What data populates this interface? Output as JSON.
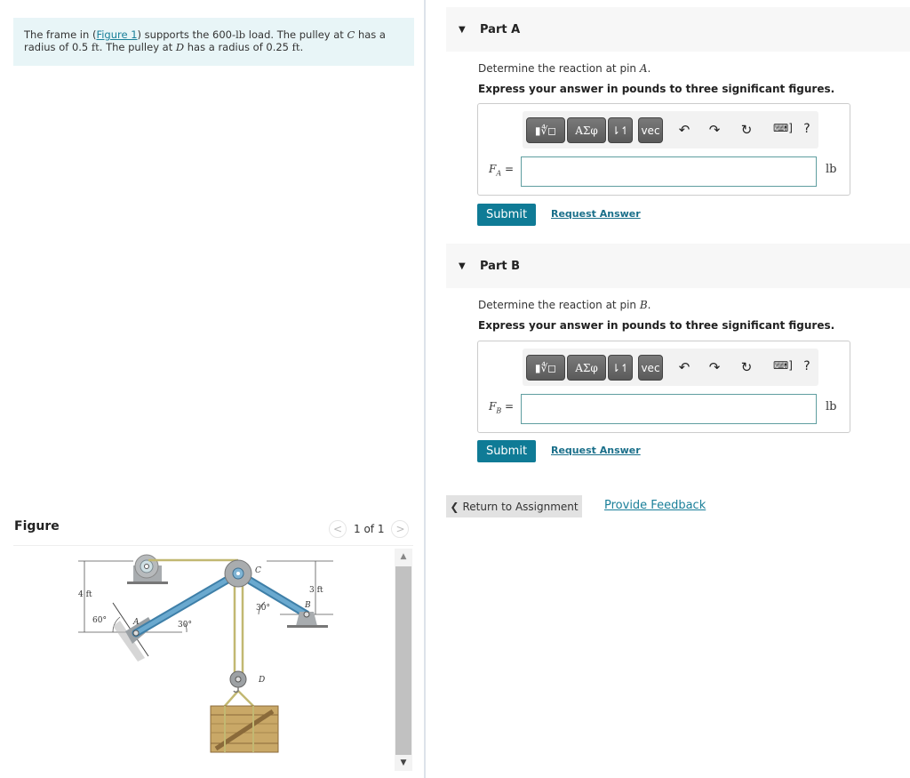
{
  "problem": {
    "text_before": "The frame in (",
    "link": "Figure 1",
    "text_mid1": ") supports the 600-",
    "unit_lb": "lb",
    "text_mid2": " load. The pulley at ",
    "C": "C",
    "text_mid3": " has a radius of 0.5 ",
    "unit_ft": "ft",
    "text_mid4": ". The pulley at ",
    "D": "D",
    "text_mid5": " has a radius of 0.25 ",
    "unit_ft2": "ft",
    "text_end": "."
  },
  "figure": {
    "title": "Figure",
    "counter": "1 of 1",
    "prev": "<",
    "next": ">",
    "labels": {
      "dim_left": "4 ft",
      "dim_right": "3 ft",
      "angle_60": "60°",
      "angle_30_A": "30°",
      "angle_30_C": "30°",
      "A": "A",
      "B": "B",
      "C": "C",
      "D": "D"
    }
  },
  "parts": [
    {
      "title": "Part A",
      "question_prefix": "Determine the reaction at pin ",
      "pin": "A",
      "question_suffix": ".",
      "instruction": "Express your answer in pounds to three significant figures.",
      "var": "F",
      "var_sub": "A",
      "equals": "=",
      "value": "",
      "unit": "lb",
      "submit": "Submit",
      "request": "Request Answer"
    },
    {
      "title": "Part B",
      "question_prefix": "Determine the reaction at pin ",
      "pin": "B",
      "question_suffix": ".",
      "instruction": "Express your answer in pounds to three significant figures.",
      "var": "F",
      "var_sub": "B",
      "equals": "=",
      "value": "",
      "unit": "lb",
      "submit": "Submit",
      "request": "Request Answer"
    }
  ],
  "toolbar": {
    "templates": "▮∜◻",
    "greek": "ΑΣφ",
    "arrows": "⇂↿",
    "vec": "vec",
    "undo": "↶",
    "redo": "↷",
    "reset": "↻",
    "keyboard": "⌨]",
    "help": "?"
  },
  "footer": {
    "return": "Return to Assignment",
    "return_icon": "❮",
    "feedback": "Provide Feedback"
  }
}
